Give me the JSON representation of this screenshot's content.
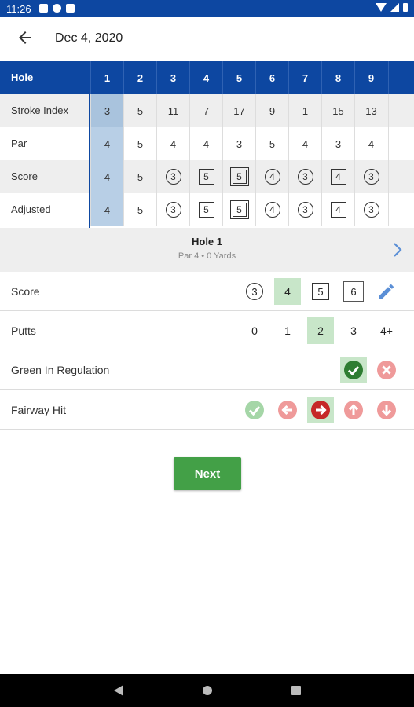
{
  "status_bar": {
    "time": "11:26"
  },
  "app_bar": {
    "title": "Dec 4, 2020"
  },
  "scorecard": {
    "header_label": "Hole",
    "holes": [
      "1",
      "2",
      "3",
      "4",
      "5",
      "6",
      "7",
      "8",
      "9"
    ],
    "rows": [
      {
        "label": "Stroke Index",
        "values": [
          "3",
          "5",
          "11",
          "7",
          "17",
          "9",
          "1",
          "15",
          "13"
        ]
      },
      {
        "label": "Par",
        "values": [
          "4",
          "5",
          "4",
          "4",
          "3",
          "5",
          "4",
          "3",
          "4"
        ]
      },
      {
        "label": "Score",
        "values": [
          "4",
          "5",
          "3",
          "5",
          "5",
          "4",
          "3",
          "4",
          "3"
        ]
      },
      {
        "label": "Adjusted",
        "values": [
          "4",
          "5",
          "3",
          "5",
          "5",
          "4",
          "3",
          "4",
          "3"
        ]
      }
    ],
    "selected_hole": "1"
  },
  "hole_info": {
    "title": "Hole 1",
    "subtitle": "Par 4 • 0 Yards"
  },
  "score_entry": {
    "label": "Score",
    "options": [
      "3",
      "4",
      "5",
      "6"
    ],
    "selected": "4"
  },
  "putts_entry": {
    "label": "Putts",
    "options": [
      "0",
      "1",
      "2",
      "3",
      "4+"
    ],
    "selected": "2"
  },
  "gir_entry": {
    "label": "Green In Regulation",
    "selected": "yes"
  },
  "fairway_entry": {
    "label": "Fairway Hit",
    "selected": "right"
  },
  "next_button": {
    "label": "Next"
  },
  "colors": {
    "primary": "#0d47a1",
    "accent_green": "#43a047",
    "light_green": "#c8e6c9",
    "miss_red": "#c62828",
    "faded_red": "#ef9a9a",
    "faded_green": "#a5d6a7"
  }
}
